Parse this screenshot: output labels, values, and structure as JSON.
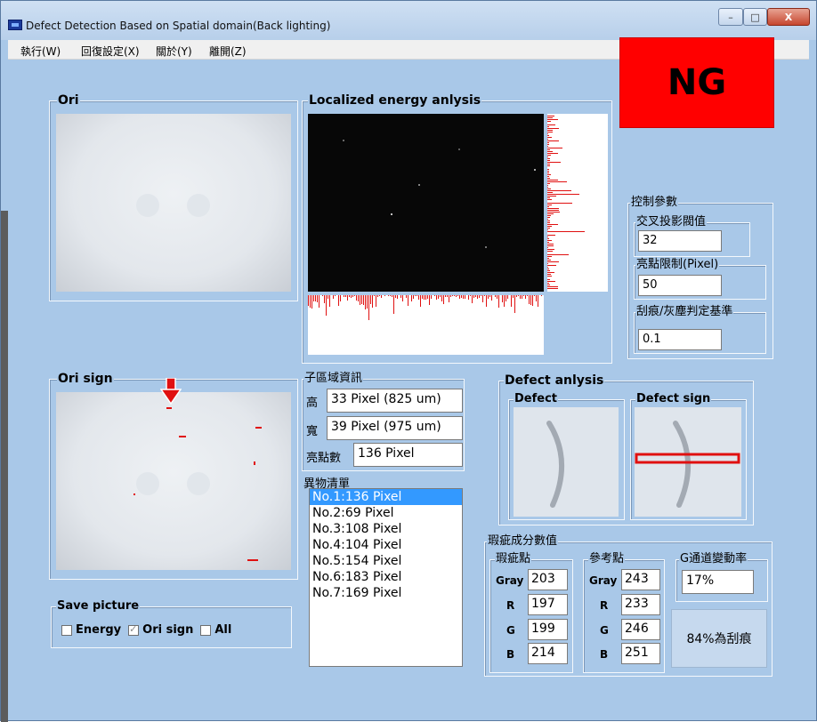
{
  "window": {
    "title": "Defect Detection Based on Spatial domain(Back lighting)",
    "controls": [
      "–",
      "□",
      "X"
    ]
  },
  "menu": [
    "執行(W)",
    "回復設定(X)",
    "關於(Y)",
    "離開(Z)"
  ],
  "groups": {
    "ori": "Ori",
    "ori_sign": "Ori sign",
    "energy": "Localized energy anlysis",
    "control": "控制參數",
    "sub_region": "子區域資訊",
    "foreign_list": "異物清單",
    "defect_analysis": "Defect anlysis",
    "defect": "Defect",
    "defect_sign": "Defect sign",
    "save_picture": "Save picture",
    "defect_scores": "瑕疵成分數值",
    "defect_point": "瑕疵點",
    "reference_point": "參考點",
    "g_change": "G通道變動率"
  },
  "result": "NG",
  "controls_panel": {
    "cross_projection_label": "交叉投影閥值",
    "cross_projection_value": "32",
    "bright_limit_label": "亮點限制(Pixel)",
    "bright_limit_value": "50",
    "scratch_label": "刮痕/灰塵判定基準",
    "scratch_value": "0.1"
  },
  "sub_region": {
    "height_label": "高",
    "height_value": "33 Pixel (825 um)",
    "width_label": "寬",
    "width_value": "39 Pixel (975 um)",
    "count_label": "亮點數",
    "count_value": "136 Pixel"
  },
  "foreign_items": [
    "No.1:136 Pixel",
    "No.2:69 Pixel",
    "No.3:108 Pixel",
    "No.4:104 Pixel",
    "No.5:154 Pixel",
    "No.6:183 Pixel",
    "No.7:169 Pixel"
  ],
  "save_options": [
    {
      "label": "Energy",
      "checked": false
    },
    {
      "label": "Ori sign",
      "checked": true
    },
    {
      "label": "All",
      "checked": false
    }
  ],
  "channel_labels": [
    "Gray",
    "R",
    "G",
    "B"
  ],
  "defect_values": [
    "203",
    "197",
    "199",
    "214"
  ],
  "reference_values": [
    "243",
    "233",
    "246",
    "251"
  ],
  "g_change_value": "17%",
  "verdict_button": "84%為刮痕",
  "colors": {
    "window_bg": "#a9c8e8",
    "ng": "#ff0000",
    "marker": "#e01010",
    "selected": "#3399ff"
  }
}
